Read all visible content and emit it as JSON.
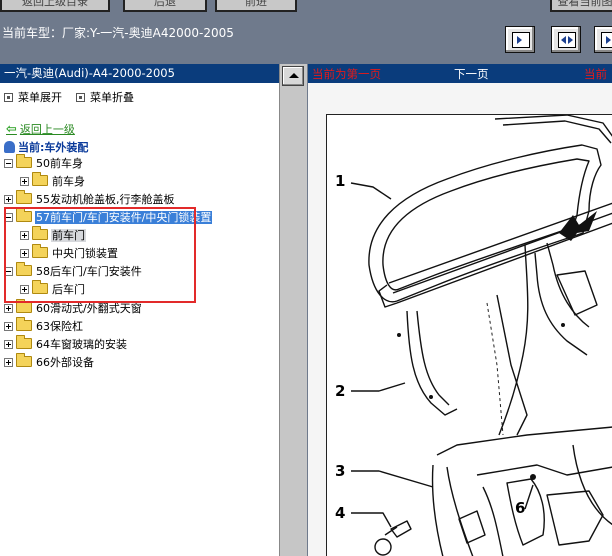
{
  "toolbar": {
    "buttons": [
      "返回上级目录",
      "后退",
      "前进",
      "查看当前图"
    ]
  },
  "model_line": {
    "label": "当前车型：",
    "value": "厂家:Y-一汽-奥迪A42000-2005"
  },
  "view_buttons": [
    "fit-page-icon",
    "fit-width-icon",
    "actual-size-icon"
  ],
  "tree": {
    "header": "一汽-奥迪(Audi)-A4-2000-2005",
    "expand_all": "菜单展开",
    "collapse_all": "菜单折叠",
    "back": "返回上一级",
    "current": "当前:车外装配",
    "items": [
      {
        "label": "50前车身",
        "level": 0
      },
      {
        "label": "前车身",
        "level": 1
      },
      {
        "label": "55发动机舱盖板,行李舱盖板",
        "level": 0
      },
      {
        "label": "57前车门/车门安装件/中央门锁装置",
        "level": 0
      },
      {
        "label": "前车门",
        "level": 1
      },
      {
        "label": "中央门锁装置",
        "level": 1
      },
      {
        "label": "58后车门/车门安装件",
        "level": 0
      },
      {
        "label": "后车门",
        "level": 1
      },
      {
        "label": "60滑动式/外翻式天窗",
        "level": 0
      },
      {
        "label": "63保险杠",
        "level": 0
      },
      {
        "label": "64车窗玻璃的安装",
        "level": 0
      },
      {
        "label": "66外部设备",
        "level": 0
      }
    ]
  },
  "viewer": {
    "first_page": "当前为第一页",
    "next_page": "下一页",
    "current_page": "当前",
    "callouts": [
      "1",
      "2",
      "3",
      "4",
      "6"
    ]
  },
  "colors": {
    "toolbar_bg": "#6f7a8c",
    "header_bg": "#0a3c7c",
    "selected_bg": "#3a7fd8",
    "highlight_box": "#e22a2a",
    "back_link": "#2a8a22",
    "nav_red": "#e21a1a"
  }
}
